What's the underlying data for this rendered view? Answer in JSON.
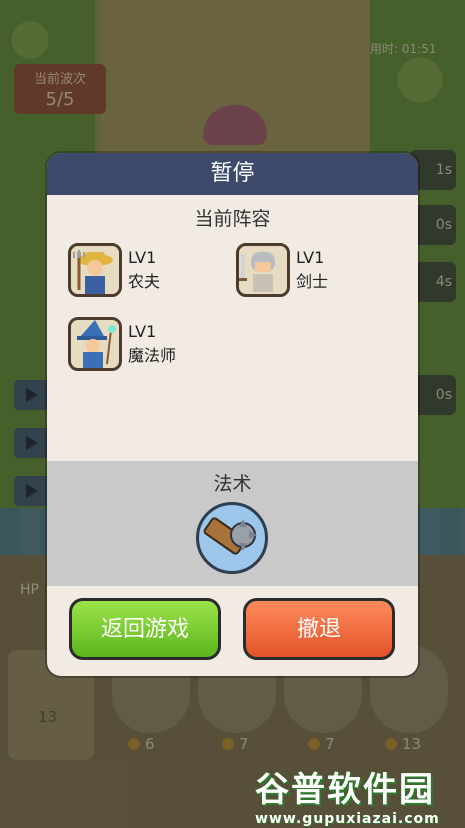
{
  "hud": {
    "timer": "用时: 01:51",
    "wave_label": "当前波次",
    "wave_value": "5/5",
    "hp_label": "HP",
    "reserve_count": "13",
    "right_slots": [
      "1s",
      "0s",
      "4s",
      "0s"
    ],
    "card_costs": [
      "6",
      "7",
      "7",
      "13"
    ]
  },
  "dialog": {
    "title": "暂停",
    "lineup_title": "当前阵容",
    "heroes": [
      {
        "level": "LV1",
        "name": "农夫",
        "icon": "farmer-portrait-icon"
      },
      {
        "level": "LV1",
        "name": "剑士",
        "icon": "swordsman-portrait-icon"
      },
      {
        "level": "LV1",
        "name": "魔法师",
        "icon": "mage-portrait-icon"
      }
    ],
    "spells_title": "法术",
    "spell_icon": "spiked-club-spell-icon",
    "return_button": "返回游戏",
    "retreat_button": "撤退"
  },
  "watermark": {
    "brand": "谷普软件园",
    "url": "www.gupuxiazai.com"
  },
  "colors": {
    "header": "#3d4a6b",
    "panel": "#f1ebe4",
    "spell_bg": "#c9c9c9",
    "return_green": "#5cb61d",
    "retreat_orange": "#e2532a"
  }
}
